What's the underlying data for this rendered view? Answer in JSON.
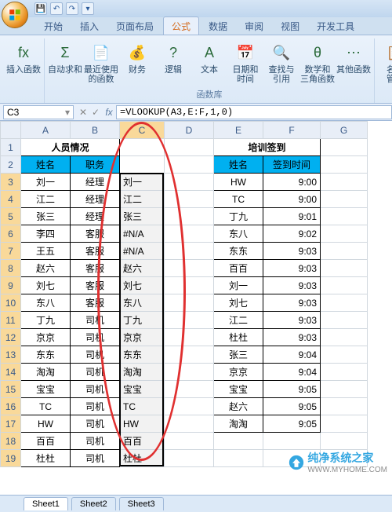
{
  "qat": {
    "save": "💾",
    "undo": "↶",
    "redo": "↷"
  },
  "tabs": [
    "开始",
    "插入",
    "页面布局",
    "公式",
    "数据",
    "审阅",
    "视图",
    "开发工具"
  ],
  "active_tab_index": 3,
  "ribbon": {
    "groups": [
      {
        "label": "",
        "buttons": [
          {
            "name": "insert-function",
            "label": "插入函数",
            "icon": "fx"
          }
        ]
      },
      {
        "label": "函数库",
        "buttons": [
          {
            "name": "autosum",
            "label": "自动求和",
            "icon": "Σ"
          },
          {
            "name": "recent",
            "label": "最近使用\n的函数",
            "icon": "📄"
          },
          {
            "name": "financial",
            "label": "财务",
            "icon": "💰"
          },
          {
            "name": "logical",
            "label": "逻辑",
            "icon": "?"
          },
          {
            "name": "text",
            "label": "文本",
            "icon": "A"
          },
          {
            "name": "datetime",
            "label": "日期和\n时间",
            "icon": "📅"
          },
          {
            "name": "lookup",
            "label": "查找与\n引用",
            "icon": "🔍"
          },
          {
            "name": "math",
            "label": "数学和\n三角函数",
            "icon": "θ"
          },
          {
            "name": "more",
            "label": "其他函数",
            "icon": "⋯"
          }
        ]
      },
      {
        "label": "",
        "buttons": [
          {
            "name": "name-manager",
            "label": "名称\n管理",
            "icon": "📋"
          }
        ]
      }
    ]
  },
  "namebox": "C3",
  "formula": "=VLOOKUP(A3,E:F,1,0)",
  "columns": [
    "A",
    "B",
    "C",
    "D",
    "E",
    "F",
    "G"
  ],
  "rows": 19,
  "selected_cell": "C3",
  "selection_range": "C3:C19",
  "table1": {
    "title": "人员情况",
    "headers": [
      "姓名",
      "职务"
    ],
    "data": [
      [
        "刘一",
        "经理"
      ],
      [
        "江二",
        "经理"
      ],
      [
        "张三",
        "经理"
      ],
      [
        "李四",
        "客服"
      ],
      [
        "王五",
        "客服"
      ],
      [
        "赵六",
        "客服"
      ],
      [
        "刘七",
        "客服"
      ],
      [
        "东八",
        "客服"
      ],
      [
        "丁九",
        "司机"
      ],
      [
        "京京",
        "司机"
      ],
      [
        "东东",
        "司机"
      ],
      [
        "淘淘",
        "司机"
      ],
      [
        "宝宝",
        "司机"
      ],
      [
        "TC",
        "司机"
      ],
      [
        "HW",
        "司机"
      ],
      [
        "百百",
        "司机"
      ],
      [
        "杜杜",
        "司机"
      ]
    ]
  },
  "colC_results": [
    "刘一",
    "江二",
    "张三",
    "#N/A",
    "#N/A",
    "赵六",
    "刘七",
    "东八",
    "丁九",
    "京京",
    "东东",
    "淘淘",
    "宝宝",
    "TC",
    "HW",
    "百百",
    "杜杜"
  ],
  "table2": {
    "title": "培训签到",
    "headers": [
      "姓名",
      "签到时间"
    ],
    "data": [
      [
        "HW",
        "9:00"
      ],
      [
        "TC",
        "9:00"
      ],
      [
        "丁九",
        "9:01"
      ],
      [
        "东八",
        "9:02"
      ],
      [
        "东东",
        "9:03"
      ],
      [
        "百百",
        "9:03"
      ],
      [
        "刘一",
        "9:03"
      ],
      [
        "刘七",
        "9:03"
      ],
      [
        "江二",
        "9:03"
      ],
      [
        "杜杜",
        "9:03"
      ],
      [
        "张三",
        "9:04"
      ],
      [
        "京京",
        "9:04"
      ],
      [
        "宝宝",
        "9:05"
      ],
      [
        "赵六",
        "9:05"
      ],
      [
        "淘淘",
        "9:05"
      ]
    ]
  },
  "sheet_tabs": [
    "Sheet1",
    "Sheet2",
    "Sheet3"
  ],
  "watermark": {
    "line1": "纯净系统之家",
    "line2": "WWW.MYHOME.COM"
  }
}
